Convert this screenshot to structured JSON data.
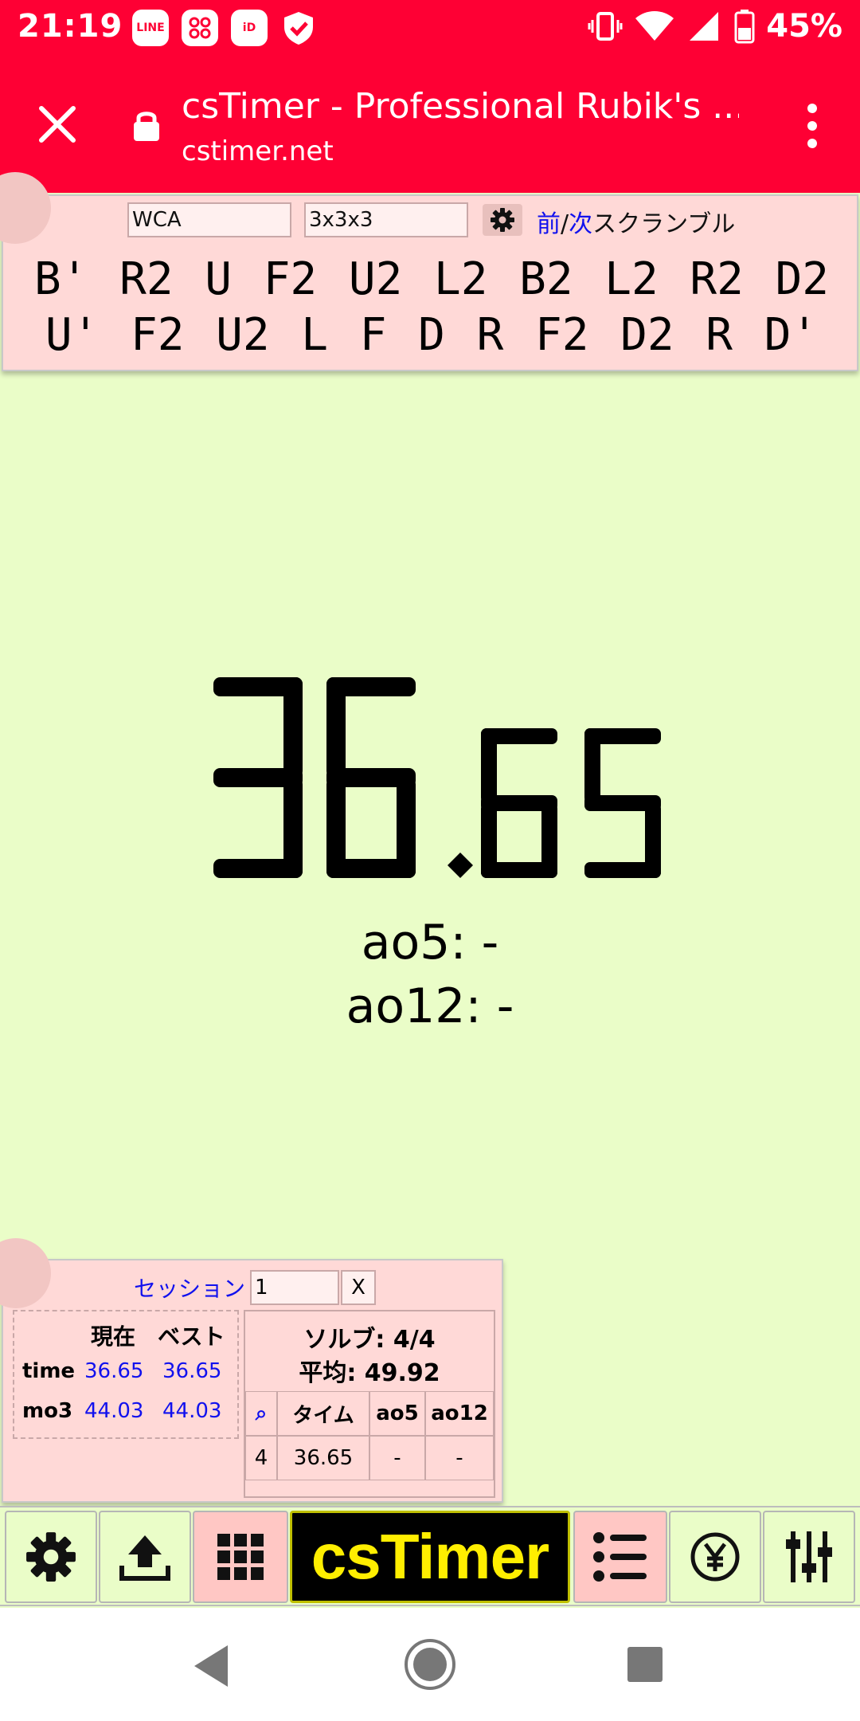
{
  "status_bar": {
    "time": "21:19",
    "notification_icons": [
      "line-icon",
      "apps-icon",
      "id-icon",
      "shield-check-icon"
    ],
    "battery_percent": "45%"
  },
  "browser": {
    "page_title": "csTimer - Professional Rubik's ...",
    "host": "cstimer.net"
  },
  "scramble_panel": {
    "scramble_type": "WCA",
    "puzzle": "3x3x3",
    "prev_label": "前",
    "separator": "/",
    "next_label": "次",
    "scramble_label": "スクランブル",
    "scramble_line1": "B' R2 U F2 U2 L2 B2 L2 R2 D2",
    "scramble_line2": "U' F2 U2 L F D R F2 D2 R D'"
  },
  "timer": {
    "seconds": "36",
    "hundredths": "65",
    "ao5": "ao5: -",
    "ao12": "ao12: -"
  },
  "stats": {
    "session_label": "セッション",
    "session_value": "1",
    "session_close": "X",
    "col_current": "現在",
    "col_best": "ベスト",
    "rows": [
      {
        "label": "time",
        "current": "36.65",
        "best": "36.65"
      },
      {
        "label": "mo3",
        "current": "44.03",
        "best": "44.03"
      }
    ],
    "solves_line": "ソルブ: 4/4",
    "mean_line": "平均: 49.92",
    "list_headers": [
      "⌕",
      "タイム",
      "ao5",
      "ao12"
    ],
    "list_rows": [
      {
        "index": "4",
        "time": "36.65",
        "ao5": "-",
        "ao12": "-"
      }
    ]
  },
  "toolbar": {
    "buttons": [
      "gear-icon",
      "export-icon",
      "scramble-grid-icon",
      "cstimer-logo",
      "stats-list-icon",
      "donate-yen-icon",
      "tools-sliders-icon"
    ],
    "logo_text": "csTimer"
  },
  "colors": {
    "browser_bar": "#fe0034",
    "background": "#eafdc8",
    "panel": "#ffd9d7",
    "link_blue": "#1111ee",
    "logo_yellow": "#ffee00"
  }
}
